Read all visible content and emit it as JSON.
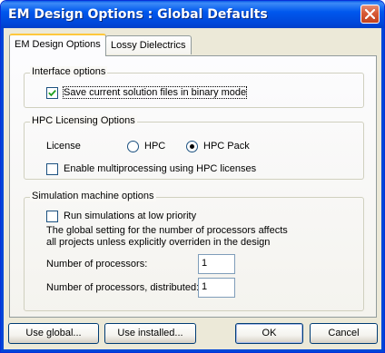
{
  "window": {
    "title": "EM Design Options : Global Defaults"
  },
  "tabs": [
    {
      "label": "EM Design Options",
      "active": true
    },
    {
      "label": "Lossy Dielectrics",
      "active": false
    }
  ],
  "interface_options": {
    "legend": "Interface options",
    "save_binary_label": "Save current solution files in binary mode",
    "save_binary_checked": true
  },
  "hpc_licensing": {
    "legend": "HPC Licensing Options",
    "license_label": "License",
    "options": [
      {
        "label": "HPC",
        "selected": false
      },
      {
        "label": "HPC Pack",
        "selected": true
      }
    ],
    "multiprocessing_label": "Enable multiprocessing using HPC licenses",
    "multiprocessing_checked": false
  },
  "simulation_machine": {
    "legend": "Simulation machine options",
    "low_priority_label": "Run simulations at low priority",
    "low_priority_checked": false,
    "note_line1": "The global setting for the number of processors affects",
    "note_line2": "all projects unless explicitly overriden in the design",
    "processors_label": "Number of processors:",
    "processors_value": "1",
    "processors_distributed_label": "Number of processors, distributed:",
    "processors_distributed_value": "1"
  },
  "buttons": {
    "use_global": "Use global...",
    "use_installed": "Use installed...",
    "ok": "OK",
    "cancel": "Cancel"
  }
}
